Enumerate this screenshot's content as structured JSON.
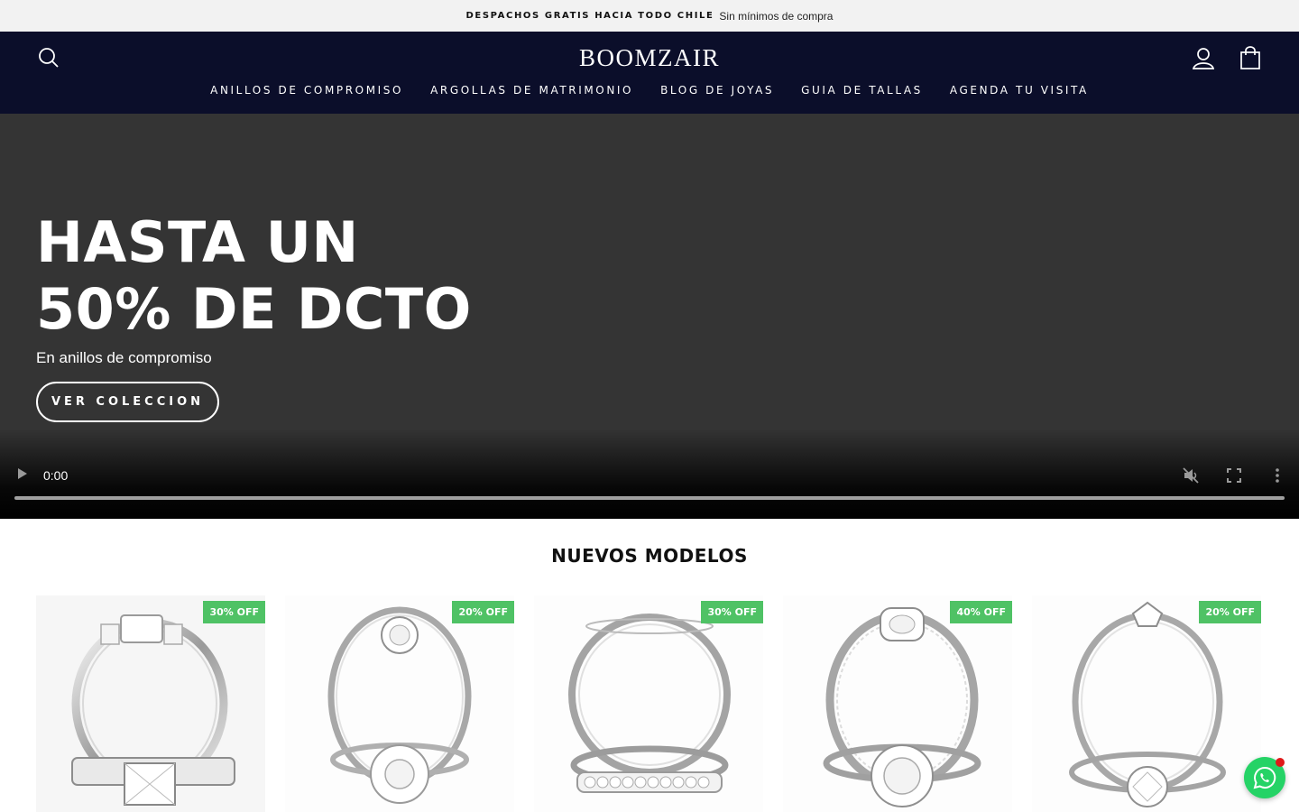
{
  "announcement": {
    "bold": "DESPACHOS GRATIS HACIA TODO CHILE",
    "light": "Sin mínimos de compra"
  },
  "header": {
    "logo": "BOOMZAIR",
    "nav": [
      "ANILLOS DE COMPROMISO",
      "ARGOLLAS DE MATRIMONIO",
      "BLOG DE JOYAS",
      "GUIA DE TALLAS",
      "AGENDA TU VISITA"
    ],
    "icons": {
      "search": "search-icon",
      "account": "user-icon",
      "cart": "bag-icon"
    },
    "background": "#0b0e2a"
  },
  "hero": {
    "headline_line1": "HASTA UN",
    "headline_line2": "50% DE DCTO",
    "subtitle": "En anillos de compromiso",
    "cta": "VER COLECCION",
    "video": {
      "time": "0:00",
      "progress": 0,
      "icons": [
        "play-icon",
        "mute-icon",
        "fullscreen-icon",
        "more-icon"
      ]
    }
  },
  "section": {
    "title": "NUEVOS MODELOS"
  },
  "products": [
    {
      "badge": "30% OFF",
      "style": "princess-three-stone"
    },
    {
      "badge": "20% OFF",
      "style": "halo-flower"
    },
    {
      "badge": "30% OFF",
      "style": "wedding-band-set"
    },
    {
      "badge": "40% OFF",
      "style": "halo-twist"
    },
    {
      "badge": "20% OFF",
      "style": "solitaire"
    }
  ],
  "colors": {
    "badge": "#4fc265",
    "whatsapp": "#25d366",
    "hero_bg": "#343434"
  },
  "whatsapp": {
    "icon": "whatsapp-icon"
  }
}
